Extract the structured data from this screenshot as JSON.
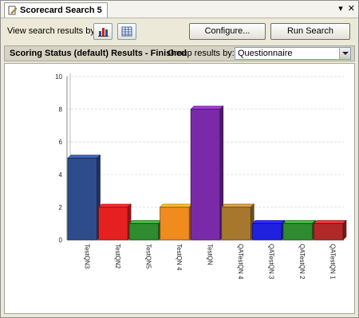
{
  "tab": {
    "title": "Scorecard Search 5",
    "dropdown_icon": "dropdown-arrow-icon",
    "close_icon": "close-icon"
  },
  "toolbar": {
    "view_label": "View search results by:",
    "chart_view_icon": "bar-chart-icon",
    "grid_view_icon": "grid-table-icon",
    "configure_label": "Configure...",
    "run_label": "Run Search"
  },
  "results": {
    "title": "Scoring Status (default) Results - Finished",
    "group_label": "Group results by: r",
    "group_value": "Questionnaire"
  },
  "chart_data": {
    "type": "bar",
    "categories": [
      "TestQN3",
      "TestQN2",
      "TestQN5",
      "TestQN 4",
      "TestQN",
      "QATestQN 4",
      "QATestQN 3",
      "QATestQN 2",
      "QATestQN 1"
    ],
    "values": [
      5,
      2,
      1,
      2,
      8,
      2,
      1,
      1,
      1
    ],
    "colors": [
      "#2e4b8c",
      "#e62020",
      "#2e8b2e",
      "#f08c1e",
      "#7a2aa8",
      "#a8772e",
      "#2020e0",
      "#2e8b2e",
      "#b02828"
    ],
    "ylim": [
      0,
      10
    ],
    "yticks": [
      "0",
      "2",
      "4",
      "6",
      "8",
      "10"
    ],
    "grid": true
  }
}
